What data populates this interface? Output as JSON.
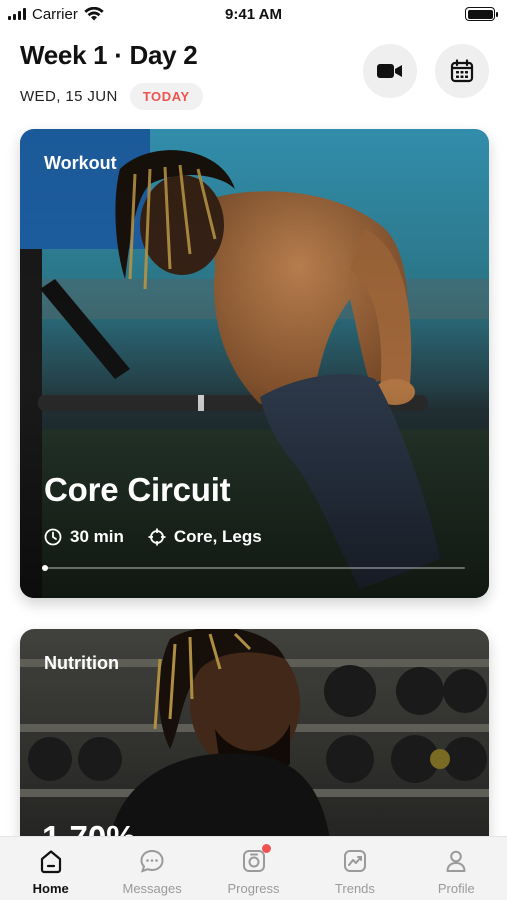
{
  "status_bar": {
    "carrier": "Carrier",
    "time": "9:41 AM"
  },
  "header": {
    "title": "Week 1 · Day 2",
    "date": "WED, 15 JUN",
    "today_badge": "TODAY",
    "actions": [
      {
        "icon": "video-camera-icon"
      },
      {
        "icon": "calendar-icon"
      }
    ]
  },
  "workout_card": {
    "label": "Workout",
    "title": "Core Circuit",
    "duration": "30 min",
    "focus": "Core, Legs",
    "progress": 0
  },
  "nutrition_card": {
    "label": "Nutrition",
    "value_partial": "1,70%"
  },
  "tab_bar": {
    "tabs": [
      {
        "label": "Home",
        "icon": "home-icon",
        "active": true
      },
      {
        "label": "Messages",
        "icon": "chat-icon",
        "active": false
      },
      {
        "label": "Progress",
        "icon": "progress-camera-icon",
        "active": false,
        "badge": true
      },
      {
        "label": "Trends",
        "icon": "trends-icon",
        "active": false
      },
      {
        "label": "Profile",
        "icon": "profile-icon",
        "active": false
      }
    ]
  },
  "colors": {
    "accent": "#ef5350",
    "tab_inactive": "#9a9a9a",
    "tab_active": "#111111"
  }
}
